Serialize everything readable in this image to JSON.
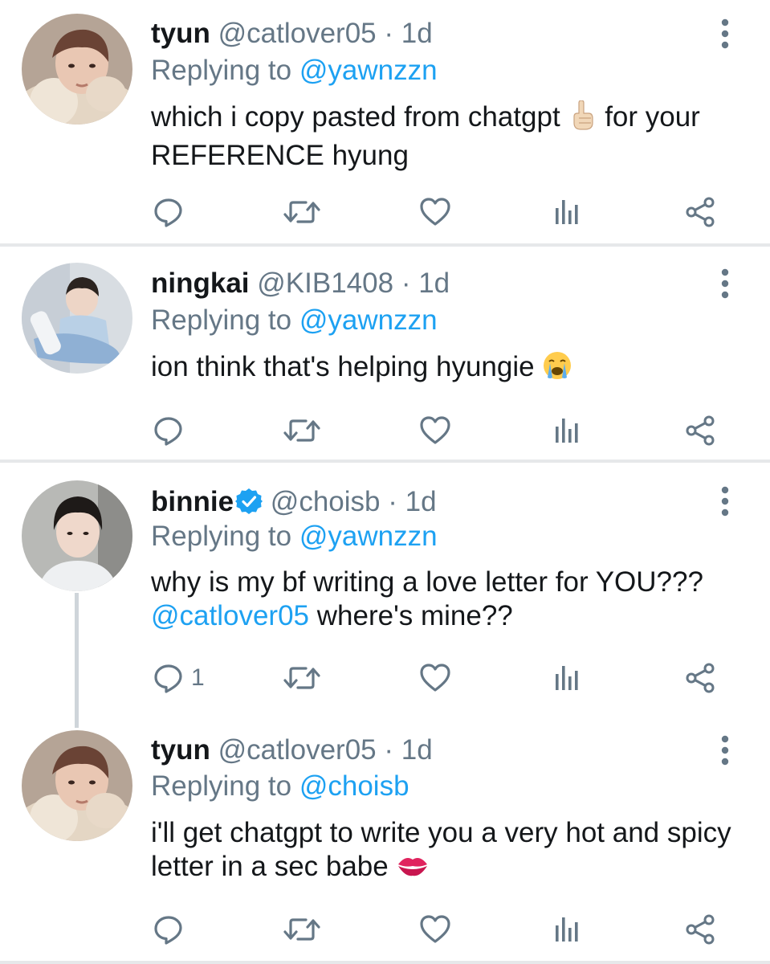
{
  "colors": {
    "text": "#14171a",
    "secondary": "#657786",
    "link": "#1da1f2",
    "divider": "#e6e8ea"
  },
  "tweets": [
    {
      "name": "tyun",
      "handle": "@catlover05",
      "dot": "·",
      "time": "1d",
      "replying_prefix": "Replying to",
      "replying_to": "@yawnzzn",
      "text_before": "which i copy pasted from chatgpt",
      "emoji": "pointing-up-emoji",
      "text_after": "for your REFERENCE hyung",
      "reply_count": ""
    },
    {
      "name": "ningkai",
      "handle": "@KIB1408",
      "dot": "·",
      "time": "1d",
      "replying_prefix": "Replying to",
      "replying_to": "@yawnzzn",
      "text_before": "ion think that's helping hyungie",
      "emoji": "loudly-crying-emoji",
      "reply_count": ""
    },
    {
      "name": "binnie",
      "verified": true,
      "handle": "@choisb",
      "dot": "·",
      "time": "1d",
      "replying_prefix": "Replying to",
      "replying_to": "@yawnzzn",
      "text_line1": "why is my bf writing a love letter for YOU???",
      "text_mention": "@catlover05",
      "text_after": "where's mine??",
      "reply_count": "1"
    },
    {
      "name": "tyun",
      "handle": "@catlover05",
      "dot": "·",
      "time": "1d",
      "replying_prefix": "Replying to",
      "replying_to": "@choisb",
      "text_before": "i'll get chatgpt to write you a very hot and spicy letter in a sec babe",
      "emoji": "kiss-mark-emoji",
      "reply_count": ""
    }
  ]
}
